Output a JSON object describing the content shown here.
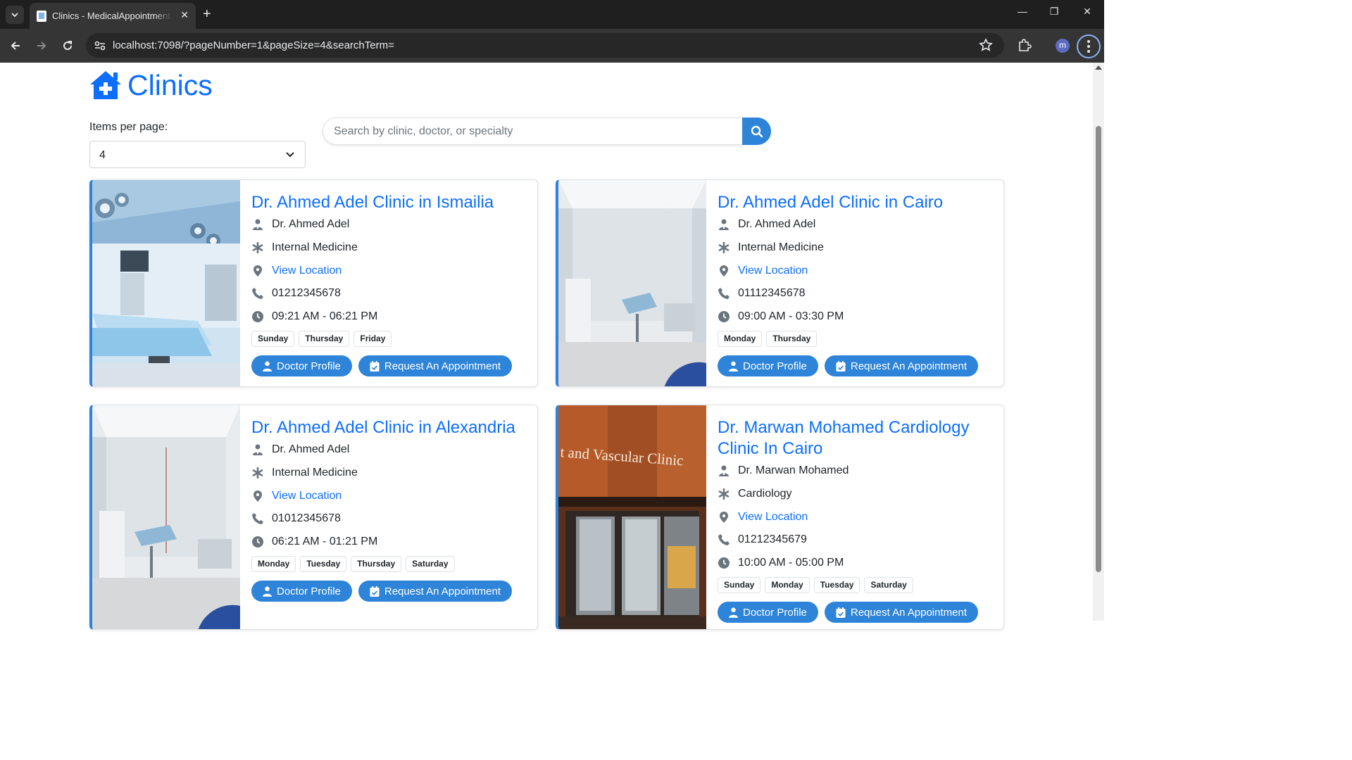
{
  "browser": {
    "tab_title": "Clinics - MedicalAppointmentsSystem",
    "url": "localhost:7098/?pageNumber=1&pageSize=4&searchTerm=",
    "profile_initial": "m"
  },
  "page": {
    "title": "Clinics",
    "items_per_page_label": "Items per page:",
    "items_per_page_value": "4",
    "search_placeholder": "Search by clinic, doctor, or specialty"
  },
  "buttons": {
    "doctor_profile": "Doctor Profile",
    "request_appointment": "Request An Appointment"
  },
  "clinics": [
    {
      "name": "Dr. Ahmed Adel Clinic in Ismailia",
      "doctor": "Dr. Ahmed Adel",
      "specialty": "Internal Medicine",
      "location_link": "View Location",
      "phone": "01212345678",
      "hours": "09:21 AM - 06:21 PM",
      "days": [
        "Sunday",
        "Thursday",
        "Friday"
      ]
    },
    {
      "name": "Dr. Ahmed Adel Clinic in Cairo",
      "doctor": "Dr. Ahmed Adel",
      "specialty": "Internal Medicine",
      "location_link": "View Location",
      "phone": "01112345678",
      "hours": "09:00 AM - 03:30 PM",
      "days": [
        "Monday",
        "Thursday"
      ]
    },
    {
      "name": "Dr. Ahmed Adel Clinic in Alexandria",
      "doctor": "Dr. Ahmed Adel",
      "specialty": "Internal Medicine",
      "location_link": "View Location",
      "phone": "01012345678",
      "hours": "06:21 AM - 01:21 PM",
      "days": [
        "Monday",
        "Tuesday",
        "Thursday",
        "Saturday"
      ]
    },
    {
      "name": "Dr. Marwan Mohamed Cardiology Clinic In Cairo",
      "doctor": "Dr. Marwan Mohamed",
      "specialty": "Cardiology",
      "location_link": "View Location",
      "phone": "01212345679",
      "hours": "10:00 AM - 05:00 PM",
      "days": [
        "Sunday",
        "Monday",
        "Tuesday",
        "Saturday"
      ],
      "photo_sign_text": "t and Vascular Clinic"
    }
  ],
  "colors": {
    "primary": "#0d6efd",
    "button": "#2d84d8",
    "chrome_dark": "#1f1f1f",
    "chrome_toolbar": "#353535"
  }
}
